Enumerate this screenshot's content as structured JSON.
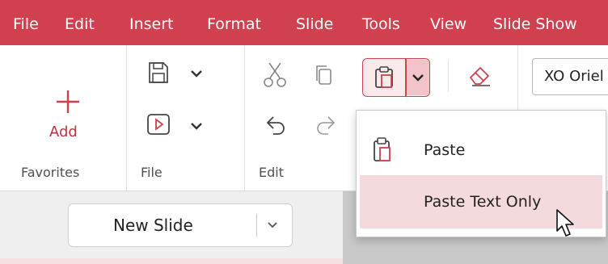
{
  "menu": {
    "items": [
      "File",
      "Edit",
      "Insert",
      "Format",
      "Slide",
      "Tools",
      "View",
      "Slide Show"
    ]
  },
  "ribbon": {
    "favorites": {
      "add_label": "Add",
      "group_label": "Favorites"
    },
    "file": {
      "group_label": "File"
    },
    "edit": {
      "group_label": "Edit"
    },
    "font": {
      "value": "XO Oriel"
    }
  },
  "paste_menu": {
    "items": [
      {
        "label": "Paste",
        "icon": "clipboard-icon"
      },
      {
        "label": "Paste Text Only",
        "hovered": true
      }
    ]
  },
  "slides": {
    "new_slide_label": "New Slide"
  },
  "colors": {
    "accent": "#d0404f",
    "hover": "#f5dadd"
  }
}
